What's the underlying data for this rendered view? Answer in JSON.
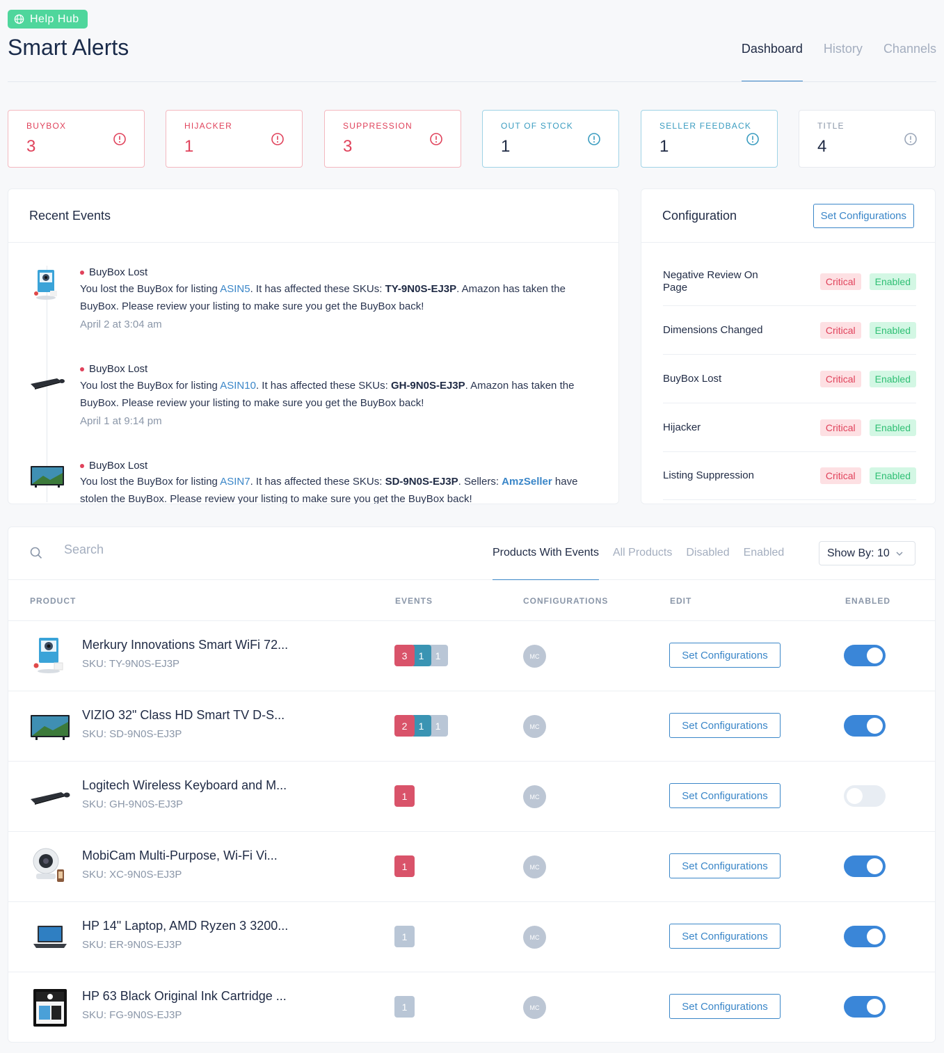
{
  "header": {
    "help_hub": "Help Hub",
    "title": "Smart Alerts",
    "tabs": [
      {
        "label": "Dashboard",
        "active": true
      },
      {
        "label": "History",
        "active": false
      },
      {
        "label": "Channels",
        "active": false
      }
    ]
  },
  "stats": [
    {
      "label": "BUYBOX",
      "value": "3",
      "tone": "red"
    },
    {
      "label": "HIJACKER",
      "value": "1",
      "tone": "red"
    },
    {
      "label": "SUPPRESSION",
      "value": "3",
      "tone": "red"
    },
    {
      "label": "OUT OF STOCK",
      "value": "1",
      "tone": "blue"
    },
    {
      "label": "SELLER FEEDBACK",
      "value": "1",
      "tone": "blue"
    },
    {
      "label": "TITLE",
      "value": "4",
      "tone": "gray"
    }
  ],
  "recent_events": {
    "title": "Recent Events",
    "items": [
      {
        "title": "BuyBox Lost",
        "text_1": "You lost the BuyBox for listing ",
        "asin": "ASIN5",
        "text_2": ". It has affected these SKUs: ",
        "sku": "TY-9N0S-EJ3P",
        "text_3": ". Amazon has taken the BuyBox. Please review your listing to make sure you get the BuyBox back!",
        "time": "April 2 at 3:04 am",
        "image": "camera-product"
      },
      {
        "title": "BuyBox Lost",
        "text_1": "You lost the BuyBox for listing ",
        "asin": "ASIN10",
        "text_2": ". It has affected these SKUs: ",
        "sku": "GH-9N0S-EJ3P",
        "text_3": ". Amazon has taken the BuyBox. Please review your listing to make sure you get the BuyBox back!",
        "time": "April 1 at 9:14 pm",
        "image": "keyboard-product"
      },
      {
        "title": "BuyBox Lost",
        "text_1": "You lost the BuyBox for listing ",
        "asin": "ASIN7",
        "text_2": ". It has affected these SKUs: ",
        "sku": "SD-9N0S-EJ3P",
        "text_3": ". Sellers: ",
        "seller": "AmzSeller",
        "text_4": " have stolen the BuyBox. Please review your listing to make sure you get the BuyBox back!",
        "image": "tv-product"
      }
    ]
  },
  "configuration": {
    "title": "Configuration",
    "button": "Set Configurations",
    "rows": [
      {
        "name": "Negative Review On Page",
        "severity": "Critical",
        "status": "Enabled"
      },
      {
        "name": "Dimensions Changed",
        "severity": "Critical",
        "status": "Enabled"
      },
      {
        "name": "BuyBox Lost",
        "severity": "Critical",
        "status": "Enabled"
      },
      {
        "name": "Hijacker",
        "severity": "Critical",
        "status": "Enabled"
      },
      {
        "name": "Listing Suppression",
        "severity": "Critical",
        "status": "Enabled"
      }
    ]
  },
  "products": {
    "search_placeholder": "Search",
    "filter_tabs": [
      {
        "label": "Products With Events",
        "active": true
      },
      {
        "label": "All Products",
        "active": false
      },
      {
        "label": "Disabled",
        "active": false
      },
      {
        "label": "Enabled",
        "active": false
      }
    ],
    "show_by": "Show By: 10",
    "columns": [
      "PRODUCT",
      "EVENTS",
      "CONFIGURATIONS",
      "EDIT",
      "ENABLED"
    ],
    "edit_label": "Set Configurations",
    "config_avatar": "MC",
    "rows": [
      {
        "name": "Merkury Innovations Smart WiFi 72...",
        "sku": "SKU: TY-9N0S-EJ3P",
        "events": {
          "red": "3",
          "teal": "1",
          "gray": "1"
        },
        "enabled": true,
        "image": "camera"
      },
      {
        "name": "VIZIO 32\" Class HD Smart TV D-S...",
        "sku": "SKU: SD-9N0S-EJ3P",
        "events": {
          "red": "2",
          "teal": "1",
          "gray": "1"
        },
        "enabled": true,
        "image": "tv"
      },
      {
        "name": "Logitech Wireless Keyboard and M...",
        "sku": "SKU: GH-9N0S-EJ3P",
        "events": {
          "red": "1"
        },
        "enabled": false,
        "image": "keyboard"
      },
      {
        "name": "MobiCam Multi-Purpose, Wi-Fi Vi...",
        "sku": "SKU: XC-9N0S-EJ3P",
        "events": {
          "red": "1"
        },
        "enabled": true,
        "image": "webcam"
      },
      {
        "name": "HP 14\" Laptop, AMD Ryzen 3 3200...",
        "sku": "SKU: ER-9N0S-EJ3P",
        "events": {
          "gray": "1"
        },
        "enabled": true,
        "image": "laptop"
      },
      {
        "name": "HP 63 Black Original Ink Cartridge ...",
        "sku": "SKU: FG-9N0S-EJ3P",
        "events": {
          "gray": "1"
        },
        "enabled": true,
        "image": "ink"
      }
    ]
  },
  "colors": {
    "accent": "#3a86c8",
    "critical": "#e0425b",
    "success": "#4fd69c",
    "info": "#3a9cc0"
  }
}
